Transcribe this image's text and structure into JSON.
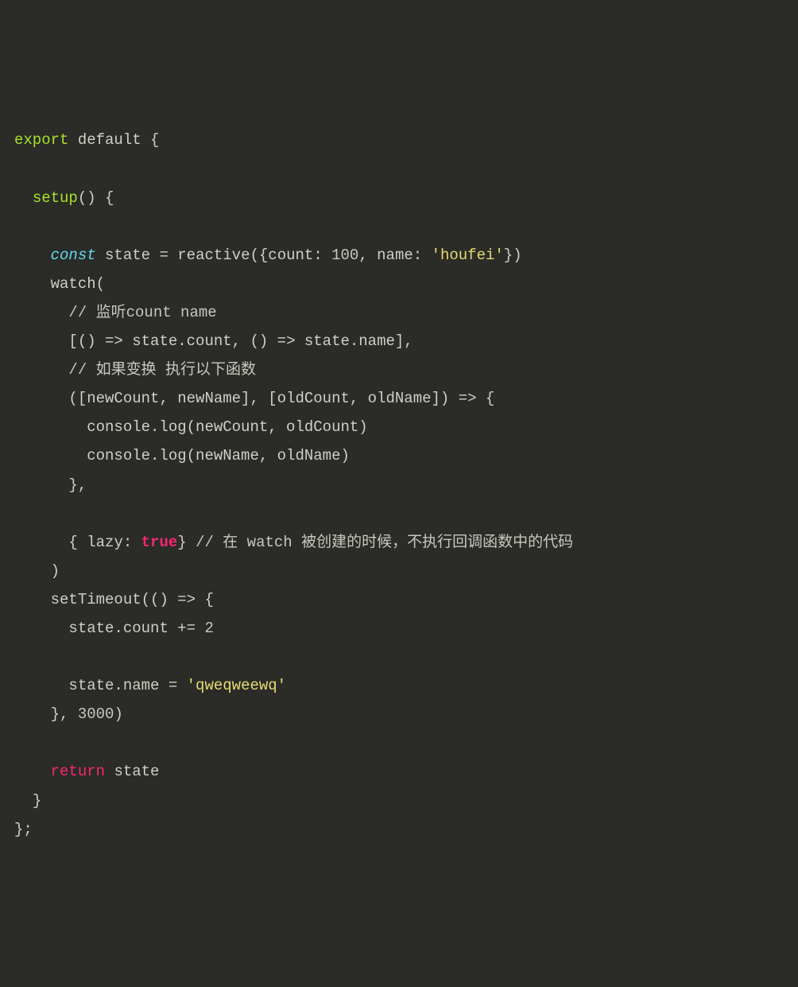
{
  "code": {
    "line1": {
      "export": "export",
      "default": "default",
      "brace": " {"
    },
    "line2": "",
    "line3": {
      "indent": "  ",
      "setup": "setup",
      "parens": "() {"
    },
    "line4": "",
    "line5": {
      "indent": "    ",
      "const": "const",
      "space1": " ",
      "state": "state",
      "space2": " ",
      "equals": "=",
      "space3": " ",
      "reactive": "reactive",
      "openParen": "({",
      "count": "count",
      "colon1": ": ",
      "num100": "100",
      "comma1": ", ",
      "name": "name",
      "colon2": ": ",
      "str": "'houfei'",
      "closeParen": "})"
    },
    "line6": {
      "indent": "    ",
      "watch": "watch",
      "open": "("
    },
    "line7": {
      "indent": "      ",
      "comment": "// 监听count name"
    },
    "line8": {
      "indent": "      ",
      "text": "[() => state.count, () => state.name],"
    },
    "line9": {
      "indent": "      ",
      "comment": "// 如果变换 执行以下函数"
    },
    "line10": {
      "indent": "      ",
      "text": "([newCount, newName], [oldCount, oldName]) => {"
    },
    "line11": {
      "indent": "        ",
      "text": "console.log(newCount, oldCount)"
    },
    "line12": {
      "indent": "        ",
      "text": "console.log(newName, oldName)"
    },
    "line13": {
      "indent": "      ",
      "text": "},"
    },
    "line14": "",
    "line15": {
      "indent": "      ",
      "open": "{ ",
      "lazy": "lazy",
      "colon": ": ",
      "true": "true",
      "close": "} ",
      "comment": "// 在 watch 被创建的时候，不执行回调函数中的代码"
    },
    "line16": {
      "indent": "    ",
      "text": ")"
    },
    "line17": {
      "indent": "    ",
      "setTimeout": "setTimeout",
      "text": "(() => {"
    },
    "line18": {
      "indent": "      ",
      "text": "state.count += ",
      "num": "2"
    },
    "line19": "",
    "line20": {
      "indent": "      ",
      "text": "state.name = ",
      "str": "'qweqweewq'"
    },
    "line21": {
      "indent": "    ",
      "close": "}, ",
      "num": "3000",
      "paren": ")"
    },
    "line22": "",
    "line23": {
      "indent": "    ",
      "return": "return",
      "space": " ",
      "state": "state"
    },
    "line24": {
      "indent": "  ",
      "text": "}"
    },
    "line25": {
      "text": "};"
    }
  }
}
